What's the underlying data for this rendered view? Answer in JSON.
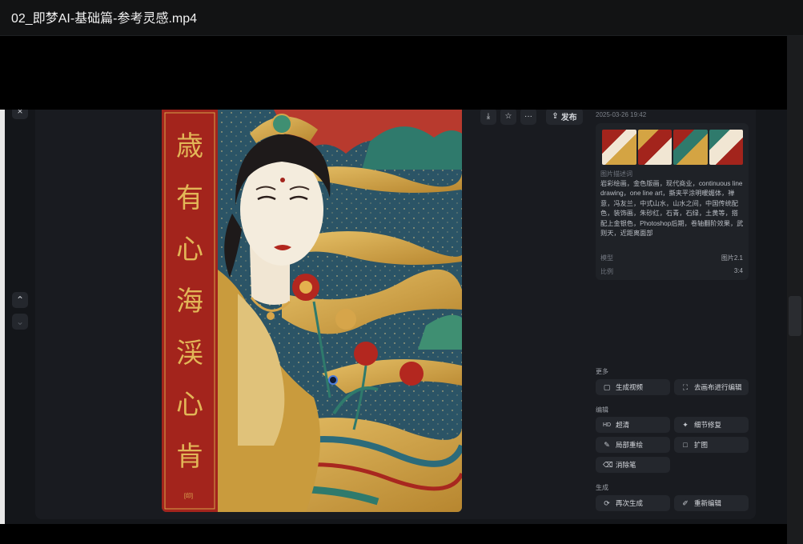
{
  "video": {
    "title": "02_即梦AI-基础篇-参考灵感.mp4"
  },
  "toolbar": {
    "download_icon": "⤓",
    "star_icon": "☆",
    "more_icon": "···",
    "publish_icon": "⇪",
    "publish_label": "发布"
  },
  "nav": {
    "close_icon": "×",
    "up_icon": "⌃",
    "down_icon": "⌄"
  },
  "artwork": {
    "calligraphy": [
      "歳",
      "有",
      "心",
      "海",
      "渓",
      "心",
      "肯"
    ],
    "seal": "[印]"
  },
  "info": {
    "timestamp": "2025-03-26 19:42",
    "description_label": "图片描述词",
    "description": "岩彩绘画，金色版画，现代商业，continuous line drawing，one line art，撕夹平涂明暖媚体，禅意，冯友兰，中式山水，山水之间，中国传统配色，装饰画，朱砂红，石青，石绿，土黄等，搭配上金银色，Photoshop后期，卷轴翻阶效果，武则天，近距离面部",
    "model_label": "模型",
    "model_value": "图片2.1",
    "ratio_label": "比例",
    "ratio_value": "3:4"
  },
  "sections": {
    "more": "更多",
    "edit": "编辑",
    "generate": "生成"
  },
  "actions": {
    "gen_video": "生成视频",
    "canvas_edit": "去画布进行编辑",
    "hd_prefix": "HD",
    "hd": "超清",
    "detail_repair": "细节修复",
    "local_redraw": "局部重绘",
    "expand": "扩图",
    "eraser": "消除笔",
    "regenerate": "再次生成",
    "re_edit": "重新编辑"
  },
  "colors": {
    "accent_red": "#a3241c",
    "gold": "#d4a443",
    "teal": "#2f6f74",
    "panel": "#1f2227"
  }
}
